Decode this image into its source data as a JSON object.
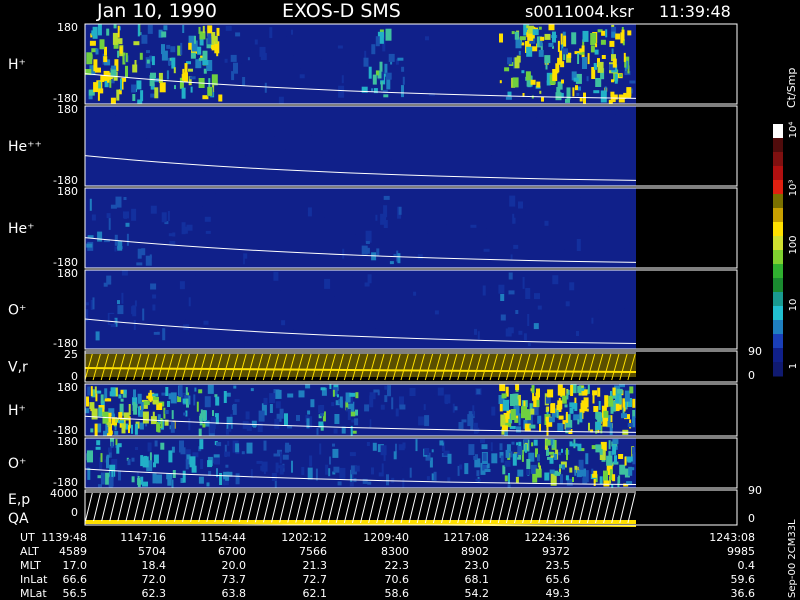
{
  "header": {
    "date": "Jan 10, 1990",
    "instrument": "EXOS-D SMS",
    "file": "s0011004.ksr",
    "time": "11:39:48"
  },
  "colorbar": {
    "label": "Ct/Smp",
    "ticks": [
      "1",
      "10",
      "100",
      "10³",
      "10⁴"
    ]
  },
  "footer_note": "Sep-00 2CM33L",
  "colors": {
    "background": "#000000",
    "data_low": "#10208a",
    "line": "#ffffff",
    "yellow": "#ffe000"
  },
  "chart_data": {
    "type": "heatmap",
    "title": "Jan 10, 1990   EXOS-D SMS   s0011004.ksr   11:39:48",
    "panels": [
      {
        "label": "H⁺",
        "y_ticks": [
          "180",
          "-180"
        ],
        "kind": "spectrogram",
        "activity": [
          1.0,
          0.7,
          0.9,
          0.25,
          0.15,
          0.12,
          0.55,
          0.1,
          0.1,
          0.9,
          0.95,
          1.0
        ]
      },
      {
        "label": "He⁺⁺",
        "y_ticks": [
          "180",
          "-180"
        ],
        "kind": "spectrogram",
        "activity": [
          0.05,
          0.05,
          0.05,
          0.05,
          0.05,
          0.05,
          0.05,
          0.05,
          0.05,
          0.05,
          0.05,
          0.05
        ]
      },
      {
        "label": "He⁺",
        "y_ticks": [
          "180",
          "-180"
        ],
        "kind": "spectrogram",
        "activity": [
          0.35,
          0.25,
          0.15,
          0.1,
          0.1,
          0.1,
          0.3,
          0.1,
          0.1,
          0.15,
          0.1,
          0.1
        ]
      },
      {
        "label": "O⁺",
        "y_ticks": [
          "180",
          "-180"
        ],
        "kind": "spectrogram",
        "activity": [
          0.3,
          0.2,
          0.15,
          0.1,
          0.1,
          0.1,
          0.1,
          0.1,
          0.1,
          0.3,
          0.1,
          0.1
        ]
      },
      {
        "label": "V,r",
        "y_ticks": [
          "25",
          "0"
        ],
        "right_ticks": [
          "90",
          "0"
        ],
        "kind": "line"
      },
      {
        "label": "H⁺",
        "y_ticks": [
          "180",
          "-180"
        ],
        "kind": "spectrogram",
        "activity": [
          0.95,
          0.8,
          0.6,
          0.35,
          0.35,
          0.6,
          0.25,
          0.2,
          0.25,
          0.95,
          1.0,
          1.0
        ]
      },
      {
        "label": "O⁺",
        "y_ticks": [
          "180",
          "-180"
        ],
        "kind": "spectrogram",
        "activity": [
          0.55,
          0.5,
          0.4,
          0.35,
          0.3,
          0.3,
          0.3,
          0.3,
          0.35,
          0.7,
          0.75,
          0.8
        ]
      },
      {
        "label": "E,p",
        "label2": "QA",
        "y_ticks": [
          "4000",
          "0"
        ],
        "right_ticks": [
          "90",
          "0"
        ],
        "kind": "line"
      }
    ],
    "x_axis": {
      "rows": [
        {
          "label": "UT",
          "values": [
            "1139:48",
            "1147:16",
            "1154:44",
            "1202:12",
            "1209:40",
            "1217:08",
            "1224:36",
            "1243:08"
          ]
        },
        {
          "label": "ALT",
          "values": [
            "4589",
            "5704",
            "6700",
            "7566",
            "8300",
            "8902",
            "9372",
            "9985"
          ]
        },
        {
          "label": "MLT",
          "values": [
            "17.0",
            "18.4",
            "20.0",
            "21.3",
            "22.3",
            "23.0",
            "23.5",
            "0.4"
          ]
        },
        {
          "label": "InLat",
          "values": [
            "66.6",
            "72.0",
            "73.7",
            "72.7",
            "70.6",
            "68.1",
            "65.6",
            "59.6"
          ]
        },
        {
          "label": "MLat",
          "values": [
            "56.5",
            "62.3",
            "63.8",
            "62.1",
            "58.6",
            "54.2",
            "49.3",
            "36.6"
          ]
        }
      ]
    }
  }
}
